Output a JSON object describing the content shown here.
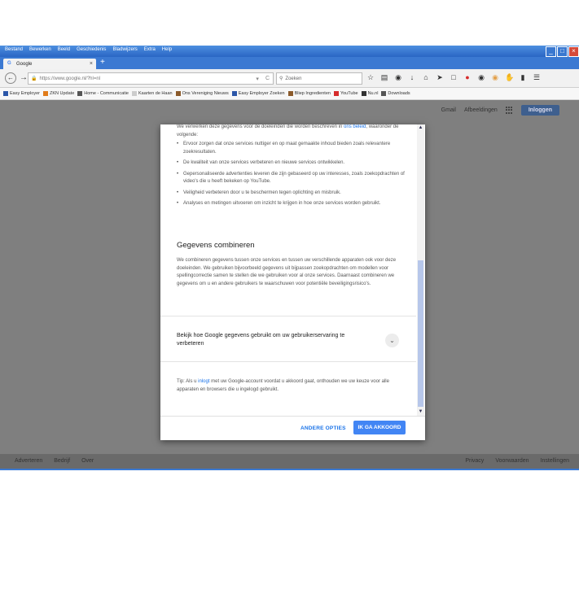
{
  "window": {
    "menu": [
      "Bestand",
      "Bewerken",
      "Beeld",
      "Geschiedenis",
      "Bladwijzers",
      "Extra",
      "Help"
    ],
    "controls": {
      "minimize": "_",
      "maximize": "□",
      "close": "×"
    }
  },
  "tab": {
    "favicon": "G",
    "title": "Google",
    "close": "×",
    "new_tab": "+"
  },
  "nav": {
    "url": "https://www.google.nl/?hl=nl",
    "reload": "C",
    "search_placeholder": "Zoeken",
    "icons": [
      "star-icon",
      "clipboard-icon",
      "pocket-icon",
      "download-icon",
      "home-icon",
      "send-icon",
      "screenshot-icon",
      "extension-icon",
      "chat-icon",
      "addon-icon",
      "adblock-icon",
      "menu-icon"
    ]
  },
  "bookmarks": [
    {
      "label": "Easy Employer",
      "color": "#2b56a8"
    },
    {
      "label": "ZKN Update",
      "color": "#e07b1a"
    },
    {
      "label": "Home - Communicatie",
      "color": "#555555"
    },
    {
      "label": "Kaarten de Haan",
      "color": "#cccccc"
    },
    {
      "label": "Ons Vereniging Nieuws",
      "color": "#8b5a2b"
    },
    {
      "label": "Easy Employer Zoeken",
      "color": "#2b56a8"
    },
    {
      "label": "Bliep Ingredienten",
      "color": "#8b5a2b"
    },
    {
      "label": "YouTube",
      "color": "#d62b2b"
    },
    {
      "label": "Nu.nl",
      "color": "#333333"
    },
    {
      "label": "Downloads",
      "color": "#555555"
    }
  ],
  "google_header": {
    "images": "Afbeeldingen",
    "other": "Gmail",
    "login": "Inloggen"
  },
  "dialog": {
    "intro": "We verwerken deze gegevens voor de doeleinden die worden beschreven in",
    "intro_link": "ons beleid",
    "intro_tail": ", waaronder de volgende:",
    "bullets": [
      "Ervoor zorgen dat onze services nuttiger en op maat gemaakte inhoud bieden zoals relevantere zoekresultaten.",
      "De kwaliteit van onze services verbeteren en nieuwe services ontwikkelen.",
      "Gepersonaliseerde advertenties leveren die zijn gebaseerd op uw interesses, zoals zoekopdrachten of video's die u heeft bekeken op YouTube.",
      "Veiligheid verbeteren door u te beschermen tegen oplichting en misbruik.",
      "Analyses en metingen uitvoeren om inzicht te krijgen in hoe onze services worden gebruikt."
    ],
    "section_title": "Gegevens combineren",
    "section_text": "We combineren gegevens tussen onze services en tussen uw verschillende apparaten ook voor deze doeleinden. We gebruiken bijvoorbeeld gegevens uit bijpassen zoekopdrachten om modellen voor spellingcorrectie samen te stellen die we gebruiken voor al onze services. Daarnaast combineren we gegevens om u en andere gebruikers te waarschuwen voor potentiële beveiligingsrisico's.",
    "expand_label": "Bekijk hoe Google gegevens gebruikt om uw gebruikerservaring te verbeteren",
    "tip_prefix": "Tip: Als u",
    "tip_link": "inlogt",
    "tip_suffix": "met uw Google-account voordat u akkoord gaat, onthouden we uw keuze voor alle apparaten en browsers die u ingelogd gebruikt.",
    "btn_options": "ANDERE OPTIES",
    "btn_agree": "IK GA AKKOORD"
  },
  "footer": {
    "left": [
      "Adverteren",
      "Bedrijf",
      "Over"
    ],
    "right": [
      "Privacy",
      "Voorwaarden",
      "Instellingen"
    ]
  }
}
